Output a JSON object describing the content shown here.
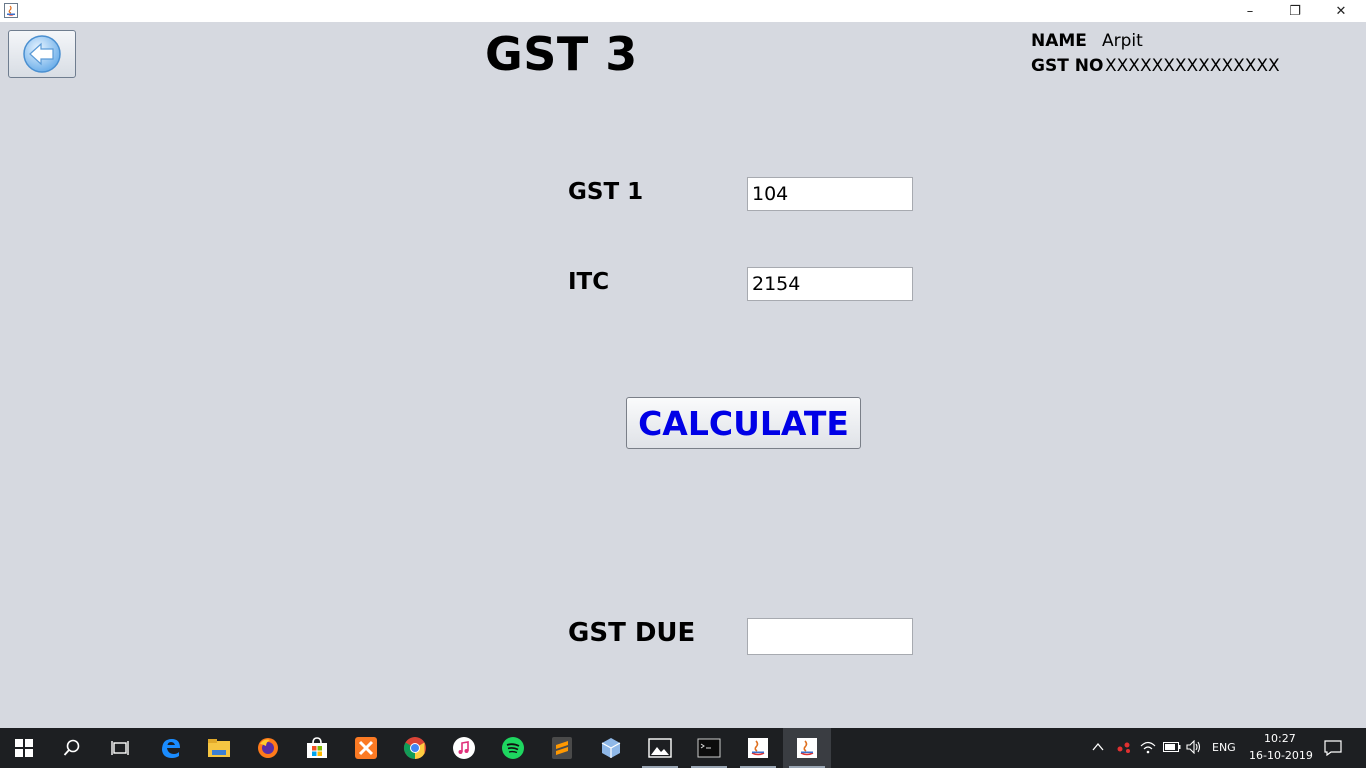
{
  "window": {
    "app_icon": "java-icon",
    "controls": {
      "minimize": "–",
      "restore": "❐",
      "close": "✕"
    }
  },
  "header": {
    "title": "GST 3",
    "back_icon": "back-arrow-icon",
    "name_label": "NAME",
    "name_value": "Arpit",
    "gstno_label": "GST NO",
    "gstno_value": "XXXXXXXXXXXXXXX"
  },
  "form": {
    "gst1_label": "GST 1",
    "gst1_value": "104",
    "itc_label": "ITC",
    "itc_value": "2154",
    "calculate_label": "CALCULATE",
    "gst_due_label": "GST DUE",
    "gst_due_value": ""
  },
  "colors": {
    "background": "#d6d9e0",
    "button_text": "#0000e6",
    "taskbar": "#1d1f22"
  },
  "taskbar": {
    "apps": [
      "edge-icon",
      "file-explorer-icon",
      "firefox-icon",
      "store-icon",
      "xampp-icon",
      "chrome-icon",
      "itunes-icon",
      "spotify-icon",
      "sublime-icon",
      "virtualbox-icon",
      "photos-icon",
      "terminal-icon",
      "java-icon",
      "java-icon"
    ],
    "language": "ENG",
    "time": "10:27",
    "date": "16-10-2019"
  }
}
